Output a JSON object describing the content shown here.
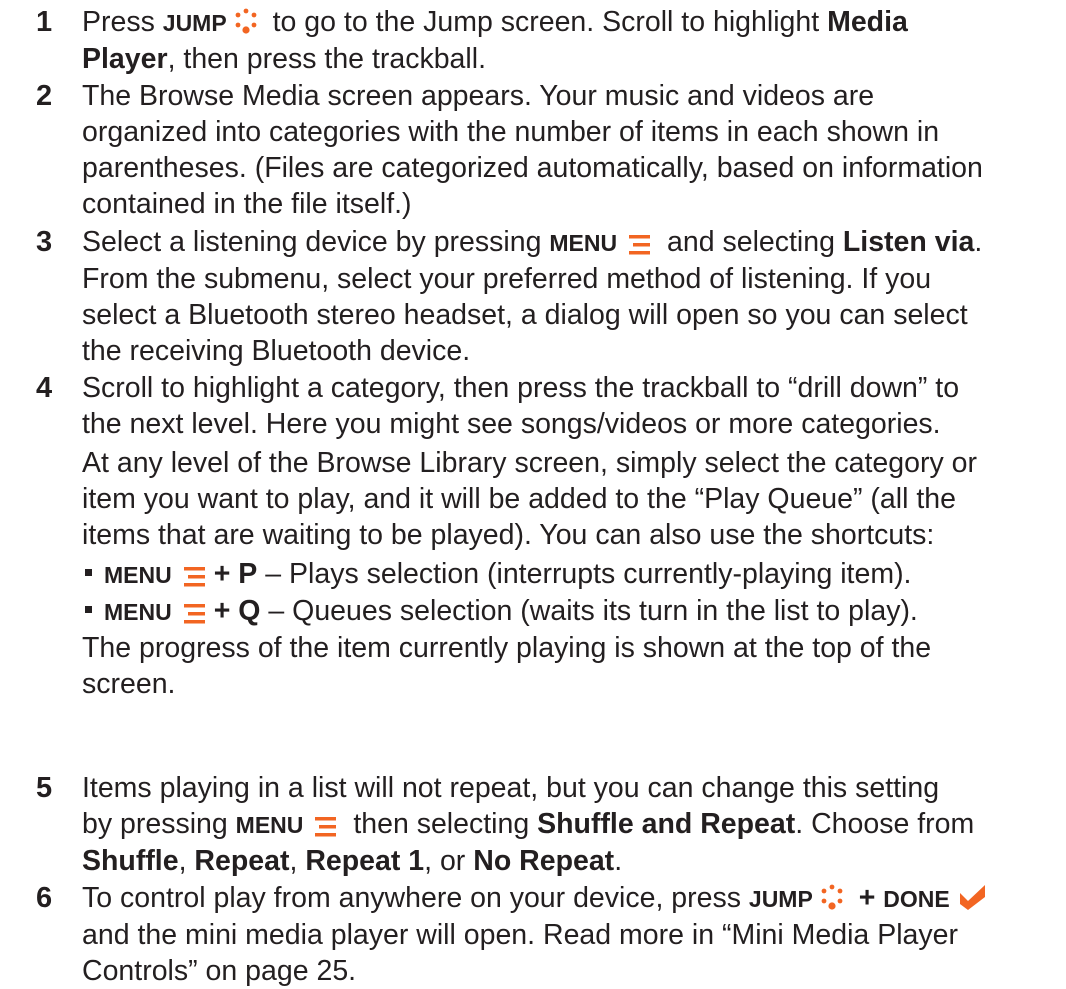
{
  "colors": {
    "text": "#231f20",
    "accent": "#f26522"
  },
  "icons": {
    "jump": "jump-icon",
    "menu": "menu-icon",
    "done": "done-check-icon"
  },
  "steps": [
    {
      "num": "1",
      "l1_a": "Press ",
      "l1_kw": "JUMP",
      "l1_b": " to go to the Jump screen. Scroll to highlight ",
      "l1_bold": "Media",
      "l2_bold": "Player",
      "l2_b": ", then press the trackball."
    },
    {
      "num": "2",
      "l1": "The Browse Media screen appears. Your music and videos are",
      "l2": "organized into categories with the number of items in each shown in",
      "l3": "parentheses. (Files are categorized automatically, based on information",
      "l4": "contained in the file itself.)"
    },
    {
      "num": "3",
      "l1_a": "Select a listening device by pressing ",
      "l1_kw": "MENU",
      "l1_b": " and selecting ",
      "l1_bold": "Listen via",
      "l1_c": ".",
      "l2": "From the submenu, select your preferred method of listening. If you",
      "l3": "select a Bluetooth stereo headset, a dialog will open so you can select",
      "l4": "the receiving Bluetooth device."
    },
    {
      "num": "4",
      "l1": "Scroll to highlight a category, then press the trackball to “drill down” to",
      "l2": "the next level. Here you might see songs/videos or more categories.",
      "p1": "At any level of the Browse Library screen, simply select the category or",
      "p2": "item you want to play, and it will be added to the “Play Queue” (all the",
      "p3": "items that are waiting to be played). You can also use the shortcuts:",
      "s1_kw": "MENU",
      "s1_key": "+ P",
      "s1_text": " – Plays selection (interrupts currently-playing item).",
      "s2_kw": "MENU",
      "s2_key": "+ Q",
      "s2_text": " – Queues selection (waits its turn in the list to play).",
      "q1": "The progress of the item currently playing is shown at the top of the",
      "q2": "screen."
    },
    {
      "num": "5",
      "l1": "Items playing in a list will not repeat, but you can change this setting",
      "l2_a": "by pressing ",
      "l2_kw": "MENU",
      "l2_b": " then selecting ",
      "l2_bold": "Shuffle and Repeat",
      "l2_c": ". Choose from",
      "l3_o1": "Shuffle",
      "l3_sep1": ", ",
      "l3_o2": "Repeat",
      "l3_sep2": ", ",
      "l3_o3": "Repeat 1",
      "l3_sep3": ", or ",
      "l3_o4": "No Repeat",
      "l3_end": "."
    },
    {
      "num": "6",
      "l1_a": "To control play from anywhere on your device, press ",
      "l1_kw1": "JUMP",
      "l1_plus": " + ",
      "l1_kw2": "DONE",
      "l2": "and the mini media player will open. Read more in “Mini Media Player",
      "l3": "Controls” on page 25."
    }
  ]
}
